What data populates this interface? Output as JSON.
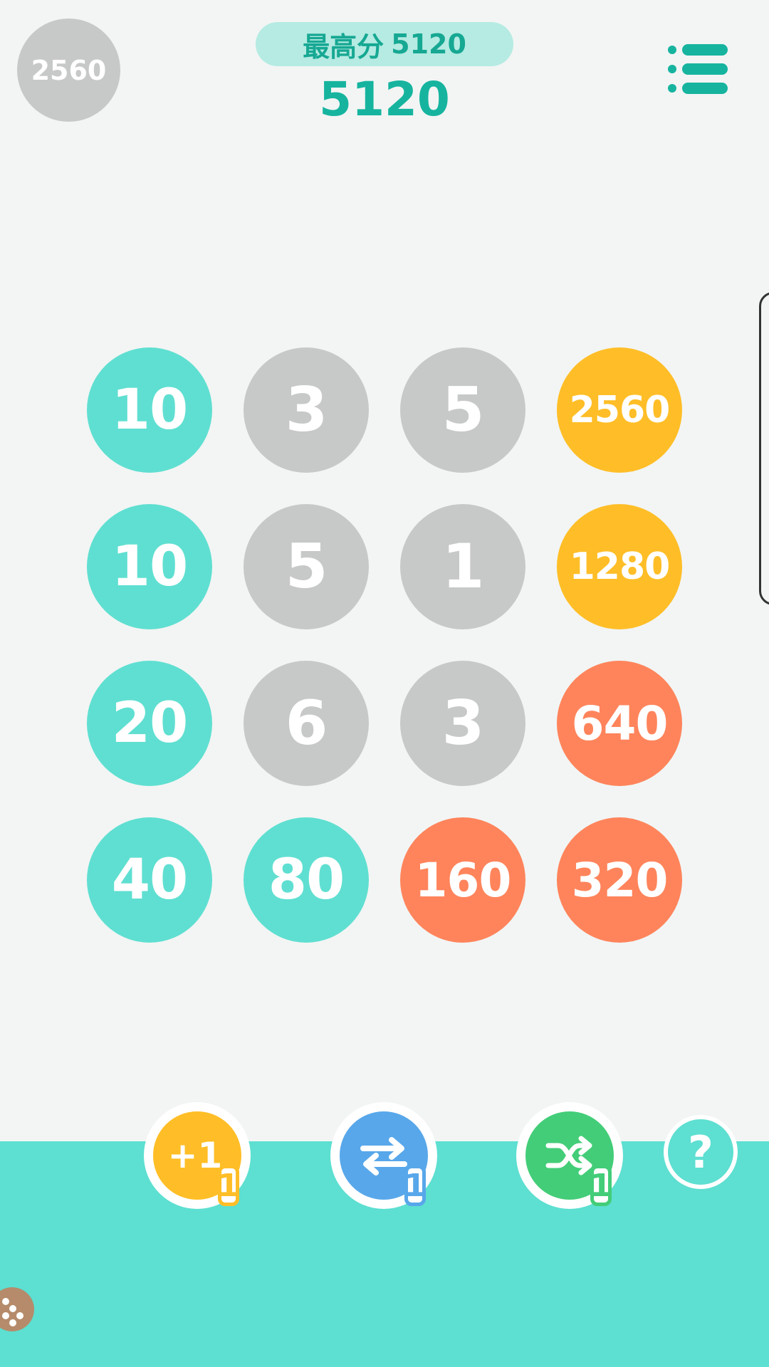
{
  "header": {
    "next_tile_value": "2560",
    "best_score_label": "最高分",
    "best_score_value": "5120",
    "current_score": "5120"
  },
  "board": [
    [
      {
        "value": "10",
        "color": "teal"
      },
      {
        "value": "3",
        "color": "gray"
      },
      {
        "value": "5",
        "color": "gray"
      },
      {
        "value": "2560",
        "color": "yellow"
      }
    ],
    [
      {
        "value": "10",
        "color": "teal"
      },
      {
        "value": "5",
        "color": "gray"
      },
      {
        "value": "1",
        "color": "gray"
      },
      {
        "value": "1280",
        "color": "yellow"
      }
    ],
    [
      {
        "value": "20",
        "color": "teal"
      },
      {
        "value": "6",
        "color": "gray"
      },
      {
        "value": "3",
        "color": "gray"
      },
      {
        "value": "640",
        "color": "orange"
      }
    ],
    [
      {
        "value": "40",
        "color": "teal"
      },
      {
        "value": "80",
        "color": "teal"
      },
      {
        "value": "160",
        "color": "orange"
      },
      {
        "value": "320",
        "color": "orange"
      }
    ]
  ],
  "tile_colors": {
    "gray": "#c7c9c8",
    "teal": "#5fdfd1",
    "orange": "#ff845b",
    "yellow": "#ffbe27"
  },
  "powerups": [
    {
      "name": "plus-one",
      "icon": "plus-one-icon",
      "text": "+1",
      "count": "1",
      "color": "#ffbe27"
    },
    {
      "name": "swap",
      "icon": "swap-arrows-icon",
      "count": "1",
      "color": "#58a7ea"
    },
    {
      "name": "shuffle",
      "icon": "shuffle-icon",
      "count": "1",
      "color": "#43cd78"
    }
  ],
  "help": {
    "icon": "question-mark-icon",
    "label": "?"
  },
  "menu": {
    "icon": "list-menu-icon"
  },
  "accent_color": "#16b49f",
  "footer_color": "#5ddfd1"
}
